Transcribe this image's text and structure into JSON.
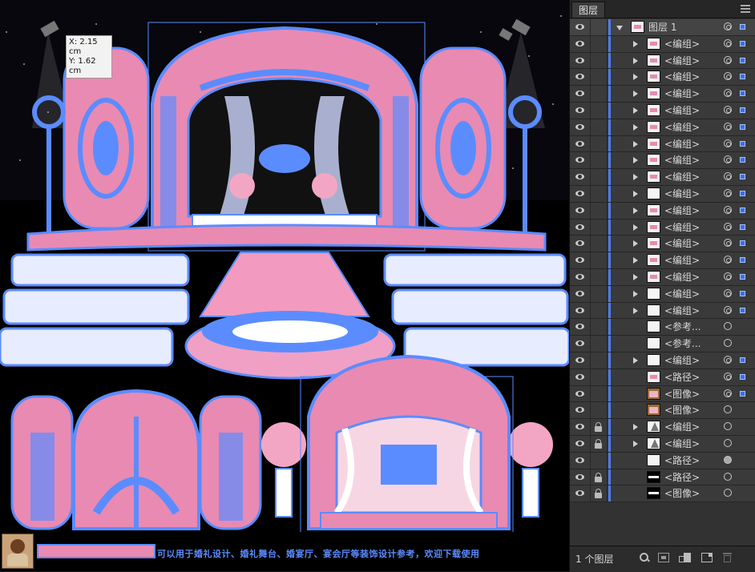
{
  "canvas": {
    "coord_tooltip": {
      "x": "X: 2.15 cm",
      "y": "Y: 1.62 cm"
    },
    "footer_caption": "可以用于婚礼设计、婚礼舞台、婚宴厅、宴会厅等装饰设计参考，欢迎下载使用"
  },
  "layers_panel": {
    "tab_title": "图层",
    "top_layer": {
      "name": "图层 1"
    },
    "items": [
      {
        "label": "<编组>",
        "thumb": "pink",
        "expandable": true,
        "locked": false,
        "target": "double",
        "selected": true
      },
      {
        "label": "<编组>",
        "thumb": "pink",
        "expandable": true,
        "locked": false,
        "target": "double",
        "selected": true
      },
      {
        "label": "<编组>",
        "thumb": "pink",
        "expandable": true,
        "locked": false,
        "target": "double",
        "selected": true
      },
      {
        "label": "<编组>",
        "thumb": "pink",
        "expandable": true,
        "locked": false,
        "target": "double",
        "selected": true
      },
      {
        "label": "<编组>",
        "thumb": "pink",
        "expandable": true,
        "locked": false,
        "target": "double",
        "selected": true
      },
      {
        "label": "<编组>",
        "thumb": "pink",
        "expandable": true,
        "locked": false,
        "target": "double",
        "selected": true
      },
      {
        "label": "<编组>",
        "thumb": "pink",
        "expandable": true,
        "locked": false,
        "target": "double",
        "selected": true
      },
      {
        "label": "<编组>",
        "thumb": "pink",
        "expandable": true,
        "locked": false,
        "target": "double",
        "selected": true
      },
      {
        "label": "<编组>",
        "thumb": "pink",
        "expandable": true,
        "locked": false,
        "target": "double",
        "selected": true
      },
      {
        "label": "<编组>",
        "thumb": "plain",
        "expandable": true,
        "locked": false,
        "target": "double",
        "selected": true
      },
      {
        "label": "<编组>",
        "thumb": "pink",
        "expandable": true,
        "locked": false,
        "target": "double",
        "selected": true
      },
      {
        "label": "<编组>",
        "thumb": "pink",
        "expandable": true,
        "locked": false,
        "target": "double",
        "selected": true
      },
      {
        "label": "<编组>",
        "thumb": "pink",
        "expandable": true,
        "locked": false,
        "target": "double",
        "selected": true
      },
      {
        "label": "<编组>",
        "thumb": "pink",
        "expandable": true,
        "locked": false,
        "target": "double",
        "selected": true
      },
      {
        "label": "<编组>",
        "thumb": "pink",
        "expandable": true,
        "locked": false,
        "target": "double",
        "selected": true
      },
      {
        "label": "<编组>",
        "thumb": "plain",
        "expandable": true,
        "locked": false,
        "target": "double",
        "selected": true
      },
      {
        "label": "<编组>",
        "thumb": "plain",
        "expandable": true,
        "locked": false,
        "target": "double",
        "selected": true
      },
      {
        "label": "<参考...",
        "thumb": "plain",
        "expandable": false,
        "locked": false,
        "target": "single",
        "selected": false
      },
      {
        "label": "<参考...",
        "thumb": "plain",
        "expandable": false,
        "locked": false,
        "target": "single",
        "selected": false
      },
      {
        "label": "<编组>",
        "thumb": "plain",
        "expandable": true,
        "locked": false,
        "target": "double",
        "selected": true
      },
      {
        "label": "<路径>",
        "thumb": "pink",
        "expandable": false,
        "locked": false,
        "target": "double",
        "selected": true
      },
      {
        "label": "<图像>",
        "thumb": "img",
        "expandable": false,
        "locked": false,
        "target": "double",
        "selected": true
      },
      {
        "label": "<图像>",
        "thumb": "img",
        "expandable": false,
        "locked": false,
        "target": "single",
        "selected": false
      },
      {
        "label": "<编组>",
        "thumb": "grey",
        "expandable": true,
        "locked": true,
        "target": "single",
        "selected": false
      },
      {
        "label": "<编组>",
        "thumb": "grey",
        "expandable": true,
        "locked": true,
        "target": "single",
        "selected": false
      },
      {
        "label": "<路径>",
        "thumb": "plain",
        "expandable": false,
        "locked": false,
        "target": "filled",
        "selected": false
      },
      {
        "label": "<路径>",
        "thumb": "dark",
        "expandable": false,
        "locked": true,
        "target": "single",
        "selected": false
      },
      {
        "label": "<图像>",
        "thumb": "dark",
        "expandable": false,
        "locked": true,
        "target": "single",
        "selected": false
      }
    ],
    "layer_count": "1 个图层"
  },
  "colors": {
    "selection_blue": "#5b8cff",
    "artwork_pink": "#e98ab2",
    "panel_bg": "#323232"
  }
}
